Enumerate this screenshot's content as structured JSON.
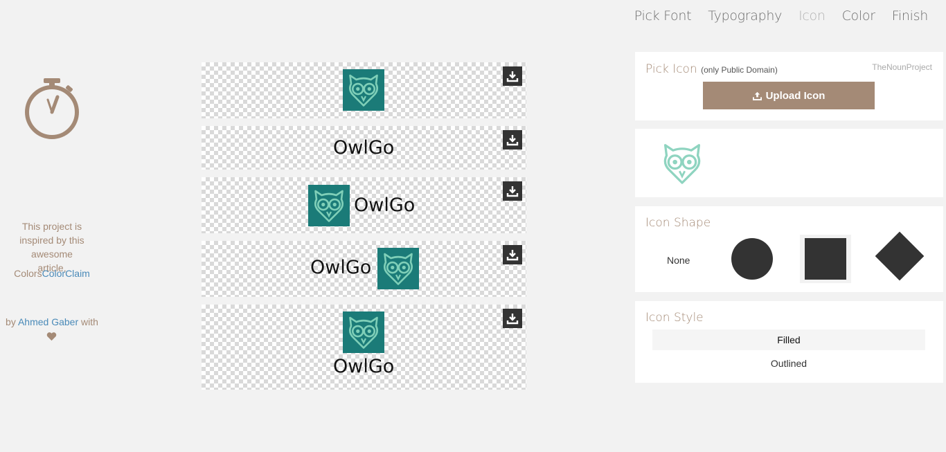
{
  "nav": {
    "items": [
      {
        "label": "Pick Font"
      },
      {
        "label": "Typography"
      },
      {
        "label": "Icon",
        "active": true
      },
      {
        "label": "Color"
      },
      {
        "label": "Finish"
      }
    ]
  },
  "sidebar": {
    "icon": "stopwatch-icon",
    "inspired_text": "This project is inspired by this awesome article,",
    "colors_prefix": "Colors",
    "colors_link": "ColorClaim",
    "by_prefix": "by",
    "author_link": "Ahmed Gaber",
    "by_suffix": "with",
    "heart_icon": "heart-icon"
  },
  "previews": {
    "brand_name": "OwlGo",
    "download_icon": "download-icon",
    "owl_icon": "owl-icon",
    "tile_color": "#1b7b78"
  },
  "pick_icon": {
    "title": "Pick Icon",
    "subtitle": "(only Public Domain)",
    "source": "TheNounProject",
    "upload_label": "Upload Icon",
    "accent": "#a48a76"
  },
  "icon_shape": {
    "title": "Icon Shape",
    "none_label": "None",
    "options": [
      "none",
      "circle",
      "square",
      "diamond"
    ],
    "selected": "square"
  },
  "icon_style": {
    "title": "Icon Style",
    "options": [
      "Filled",
      "Outlined"
    ],
    "selected": "Filled"
  }
}
